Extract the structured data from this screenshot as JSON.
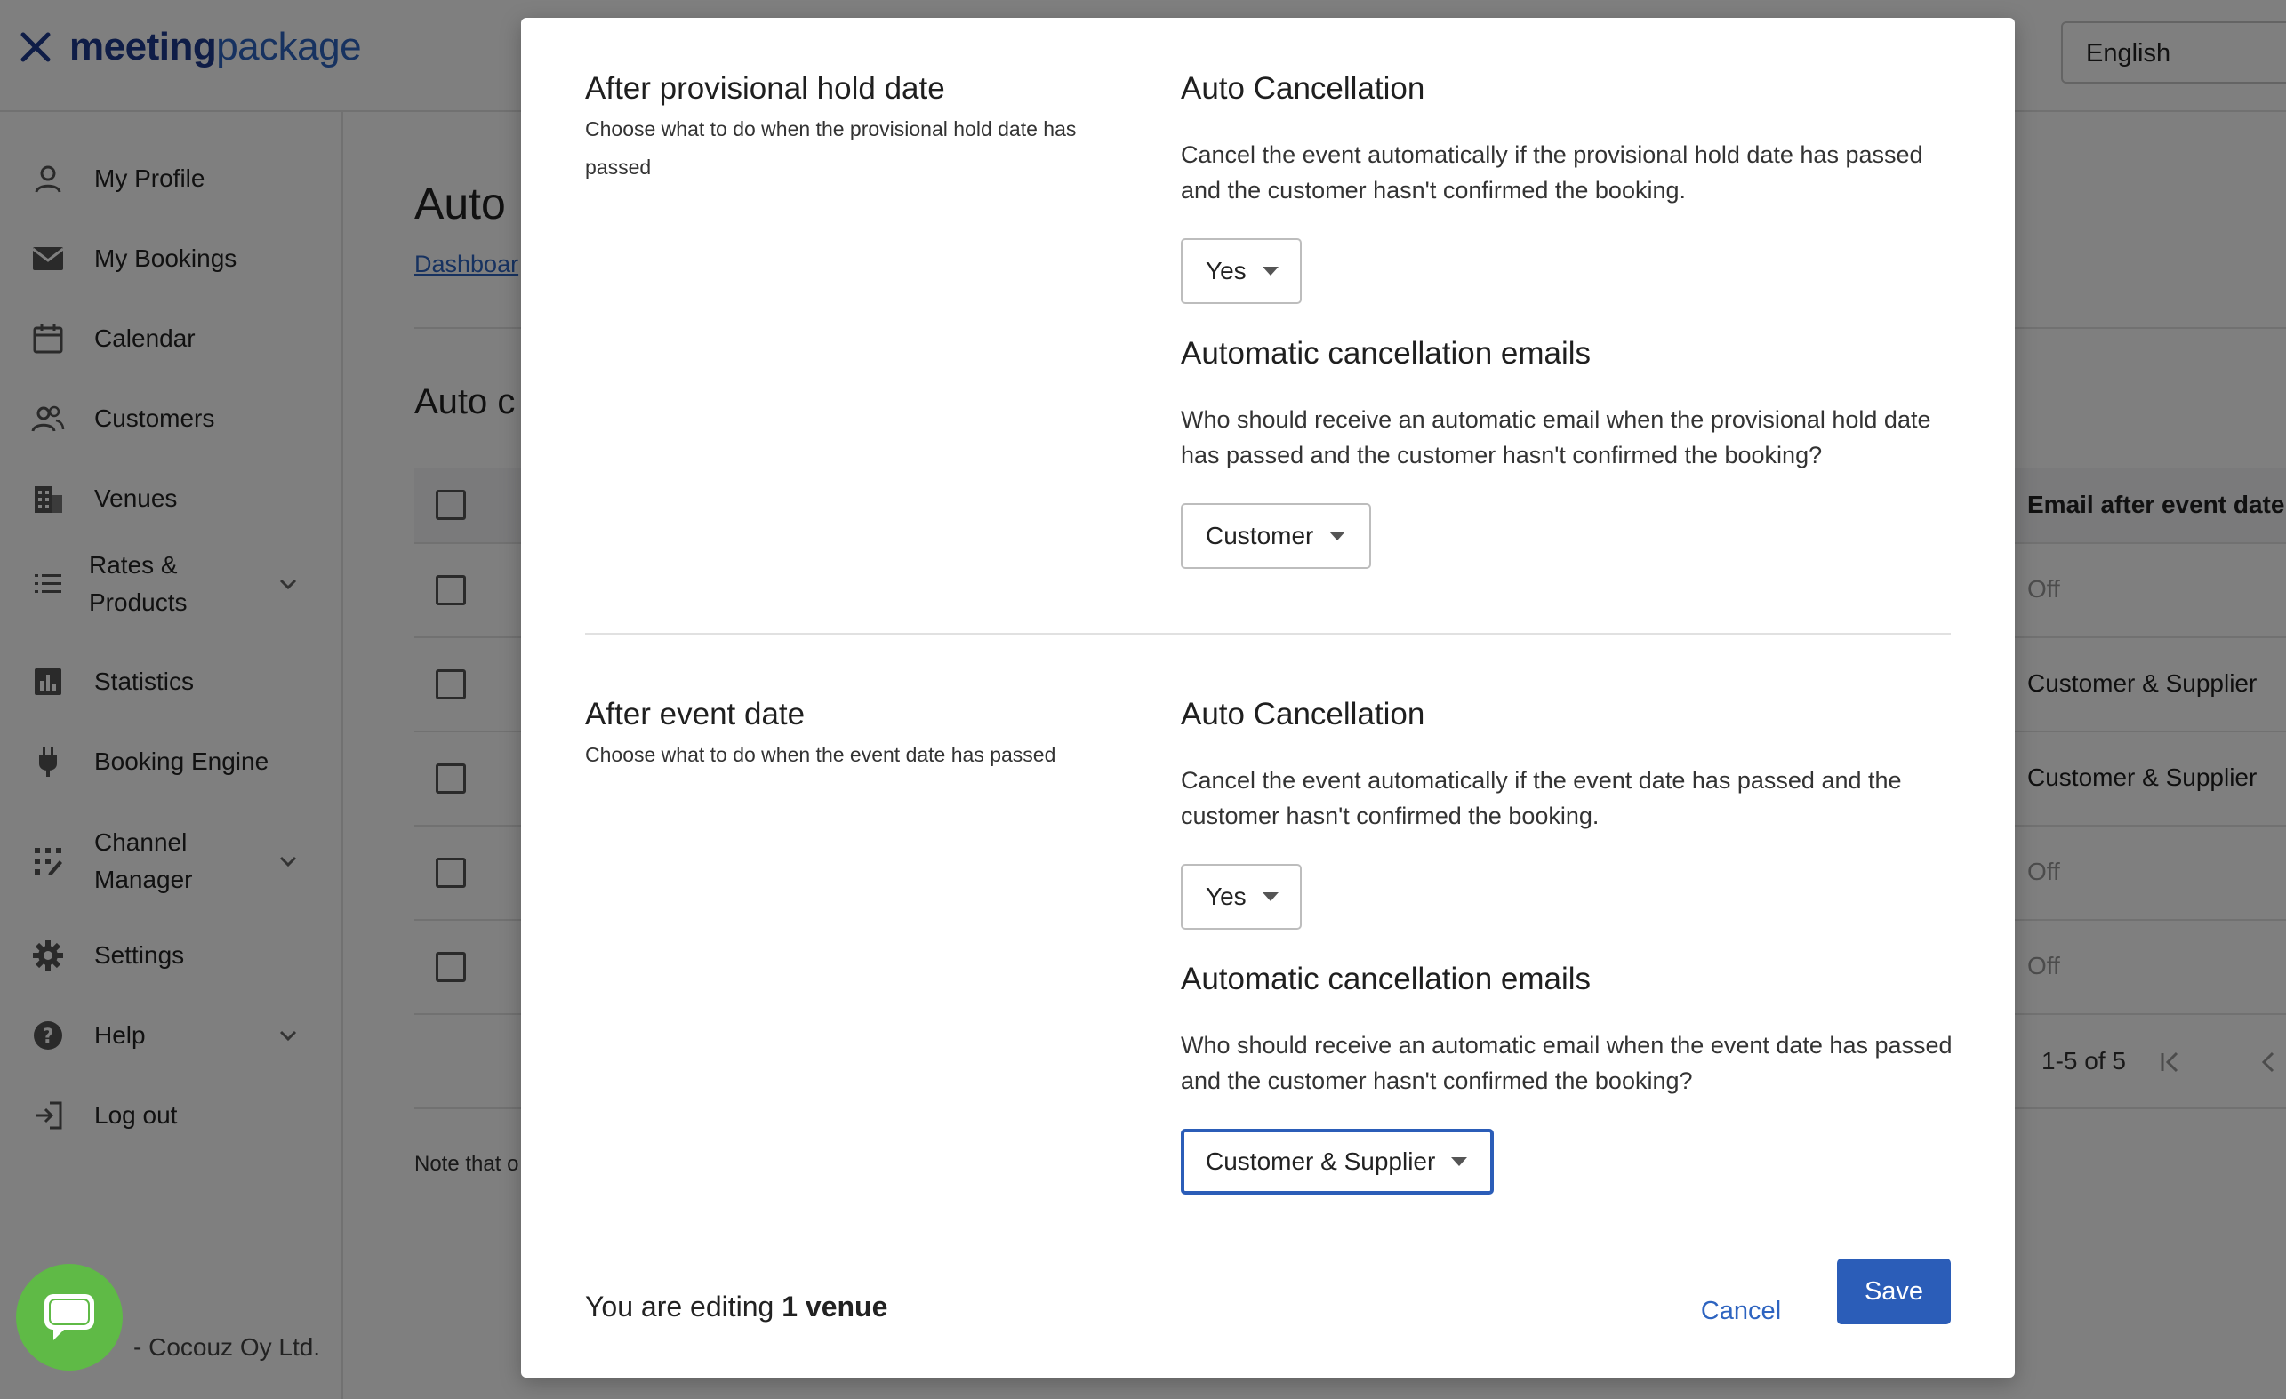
{
  "app": {
    "logo_bold": "meeting",
    "logo_light": "package",
    "language": "English"
  },
  "sidebar": {
    "items": [
      {
        "label": "My Profile"
      },
      {
        "label": "My Bookings"
      },
      {
        "label": "Calendar"
      },
      {
        "label": "Customers"
      },
      {
        "label": "Venues"
      },
      {
        "label": "Rates &\nProducts"
      },
      {
        "label": "Statistics"
      },
      {
        "label": "Booking Engine"
      },
      {
        "label": "Channel\nManager"
      },
      {
        "label": "Settings"
      },
      {
        "label": "Help"
      },
      {
        "label": "Log out"
      }
    ],
    "footer": "- Cocouz Oy Ltd."
  },
  "main": {
    "title": "Auto",
    "breadcrumb": "Dashboar",
    "section_title": "Auto c",
    "table": {
      "header_right": "Email after event date",
      "rows": [
        "Off",
        "Customer & Supplier",
        "Customer & Supplier",
        "Off",
        "Off"
      ],
      "pagination": "1-5 of 5"
    },
    "note": "Note that o"
  },
  "modal": {
    "section1": {
      "title": "After provisional hold date",
      "description": "Choose what to do when the provisional hold date has passed",
      "auto_cancel_title": "Auto Cancellation",
      "auto_cancel_desc": "Cancel the event automatically if the provisional hold date has passed and the customer hasn't confirmed the booking.",
      "auto_cancel_value": "Yes",
      "emails_title": "Automatic cancellation emails",
      "emails_desc": "Who should receive an automatic email when the provisional hold date has passed and the customer hasn't confirmed the booking?",
      "emails_value": "Customer"
    },
    "section2": {
      "title": "After event date",
      "description": "Choose what to do when the event date has passed",
      "auto_cancel_title": "Auto Cancellation",
      "auto_cancel_desc": "Cancel the event automatically if the event date has passed and the customer hasn't confirmed the booking.",
      "auto_cancel_value": "Yes",
      "emails_title": "Automatic cancellation emails",
      "emails_desc": "Who should receive an automatic email when the event date has passed and the customer hasn't confirmed the booking?",
      "emails_value": "Customer & Supplier"
    },
    "footer": {
      "editing_prefix": "You are editing",
      "editing_count": "1 venue",
      "cancel_label": "Cancel",
      "save_label": "Save"
    }
  },
  "colors": {
    "accent": "#2b5db8",
    "link": "#2e64c0",
    "chat": "#5fba46"
  }
}
